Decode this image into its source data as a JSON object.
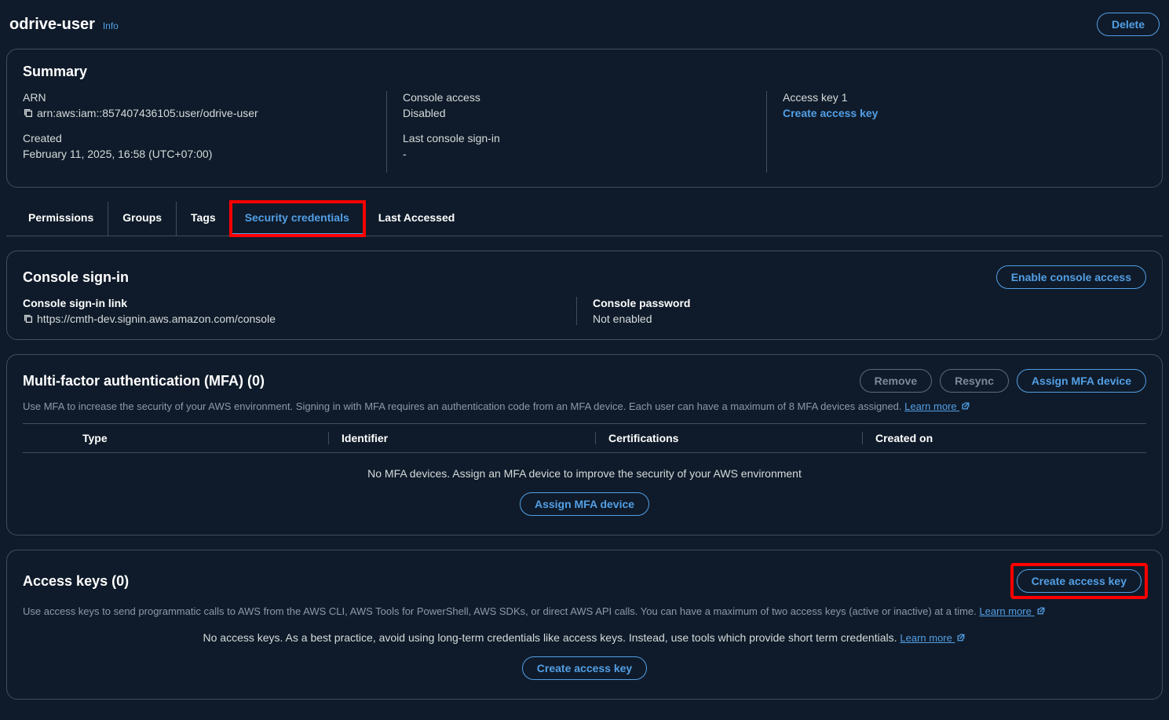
{
  "header": {
    "title": "odrive-user",
    "info": "Info",
    "delete": "Delete"
  },
  "summary": {
    "title": "Summary",
    "arn_label": "ARN",
    "arn_value": "arn:aws:iam::857407436105:user/odrive-user",
    "created_label": "Created",
    "created_value": "February 11, 2025, 16:58 (UTC+07:00)",
    "console_access_label": "Console access",
    "console_access_value": "Disabled",
    "last_signin_label": "Last console sign-in",
    "last_signin_value": "-",
    "access_key_label": "Access key 1",
    "create_access_key": "Create access key"
  },
  "tabs": {
    "permissions": "Permissions",
    "groups": "Groups",
    "tags": "Tags",
    "security": "Security credentials",
    "last_accessed": "Last Accessed"
  },
  "console_signin": {
    "title": "Console sign-in",
    "enable_btn": "Enable console access",
    "link_label": "Console sign-in link",
    "link_value": "https://cmth-dev.signin.aws.amazon.com/console",
    "password_label": "Console password",
    "password_value": "Not enabled"
  },
  "mfa": {
    "title": "Multi-factor authentication (MFA) (0)",
    "remove_btn": "Remove",
    "resync_btn": "Resync",
    "assign_btn": "Assign MFA device",
    "desc": "Use MFA to increase the security of your AWS environment. Signing in with MFA requires an authentication code from an MFA device. Each user can have a maximum of 8 MFA devices assigned.",
    "learn_more": "Learn more",
    "cols": {
      "type": "Type",
      "identifier": "Identifier",
      "certifications": "Certifications",
      "created_on": "Created on"
    },
    "empty": "No MFA devices. Assign an MFA device to improve the security of your AWS environment",
    "assign_btn2": "Assign MFA device"
  },
  "access_keys": {
    "title": "Access keys (0)",
    "create_btn": "Create access key",
    "desc": "Use access keys to send programmatic calls to AWS from the AWS CLI, AWS Tools for PowerShell, AWS SDKs, or direct AWS API calls. You can have a maximum of two access keys (active or inactive) at a time.",
    "learn_more": "Learn more",
    "empty": "No access keys. As a best practice, avoid using long-term credentials like access keys. Instead, use tools which provide short term credentials.",
    "learn_more2": "Learn more",
    "create_btn2": "Create access key"
  }
}
